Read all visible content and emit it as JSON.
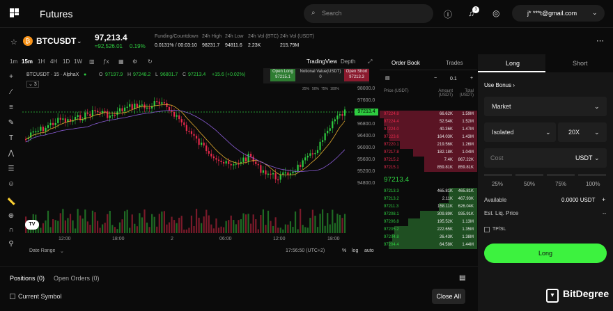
{
  "header": {
    "title": "Futures",
    "search_placeholder": "Search",
    "notif_count": "3",
    "account_email": "j* ***t@gmail.com"
  },
  "ticker": {
    "symbol": "BTCUSDT",
    "price": "97,213.4",
    "sub_price": "≈92,526.01",
    "change": "0.19%",
    "stats": [
      {
        "label": "Funding/Countdown",
        "value": "0.0131% / 00:03:10"
      },
      {
        "label": "24h High",
        "value": "98231.7"
      },
      {
        "label": "24h Low",
        "value": "94811.6"
      },
      {
        "label": "24h Vol (BTC)",
        "value": "2.23K"
      },
      {
        "label": "24h Vol (USDT)",
        "value": "215.79M"
      }
    ]
  },
  "chart": {
    "timeframes": [
      "1m",
      "15m",
      "1H",
      "4H",
      "1D",
      "1W"
    ],
    "view_tabs": [
      "TradingView",
      "Depth"
    ],
    "legend_symbol": "BTCUSDT · 15 · AlphaX",
    "ohlc": {
      "o_label": "O",
      "o": "97197.9",
      "h_label": "H",
      "h": "97248.2",
      "l_label": "L",
      "l": "96801.7",
      "c_label": "C",
      "c": "97213.4",
      "change": "+15.6 (+0.02%)"
    },
    "indicator_count": "3",
    "order_box": {
      "long": "Open Long",
      "long_price": "97215.1",
      "notional": "Notional Value(USDT)",
      "short": "Open Short",
      "short_price": "97213.3",
      "notional_value": "0",
      "pcts": [
        "25%",
        "50%",
        "75%",
        "100%"
      ]
    },
    "y_ticks": [
      "98000.0",
      "97600.0",
      "96800.0",
      "96400.0",
      "96000.0",
      "95600.0",
      "95200.0",
      "94800.0"
    ],
    "price_tag": "97213.4",
    "x_ticks": [
      "12:00",
      "18:00",
      "2",
      "06:00",
      "12:00",
      "18:00"
    ],
    "date_range": "Date Range",
    "clock": "17:56:50 (UTC+2)",
    "scale_opts": [
      "%",
      "log",
      "auto"
    ]
  },
  "orderbook": {
    "tabs": [
      "Order Book",
      "Trades"
    ],
    "precision": "0.1",
    "headers": [
      "Price (USDT)",
      "Amount (USDT)",
      "Total (USDT)"
    ],
    "asks": [
      [
        "97224.8",
        "66.62K",
        "1.59M"
      ],
      [
        "97224.4",
        "52.54K",
        "1.52M"
      ],
      [
        "97224.0",
        "40.36K",
        "1.47M"
      ],
      [
        "97223.6",
        "164.03K",
        "1.43M"
      ],
      [
        "97220.1",
        "219.56K",
        "1.26M"
      ],
      [
        "97217.8",
        "182.18K",
        "1.04M"
      ],
      [
        "97215.2",
        "7.4K",
        "867.22K"
      ],
      [
        "97215.1",
        "859.81K",
        "859.81K"
      ]
    ],
    "mid": "97213.4",
    "bids": [
      [
        "97213.3",
        "465.81K",
        "465.81K"
      ],
      [
        "97213.2",
        "2.11K",
        "467.93K"
      ],
      [
        "97211.3",
        "158.11K",
        "626.04K"
      ],
      [
        "97208.1",
        "309.89K",
        "935.91K"
      ],
      [
        "97206.8",
        "195.52K",
        "1.13M"
      ],
      [
        "97205.2",
        "222.65K",
        "1.35M"
      ],
      [
        "97204.8",
        "26.43K",
        "1.38M"
      ],
      [
        "97204.4",
        "64.58K",
        "1.44M"
      ]
    ]
  },
  "trade": {
    "tabs": [
      "Long",
      "Short"
    ],
    "use_bonus": "Use Bonus",
    "order_type": "Market",
    "margin_mode": "Isolated",
    "leverage": "20X",
    "cost_label": "Cost",
    "cost_unit": "USDT",
    "pcts": [
      "25%",
      "50%",
      "75%",
      "100%"
    ],
    "available_label": "Available",
    "available_value": "0.0000 USDT",
    "liq_label": "Est. Liq. Price",
    "liq_value": "--",
    "tpsl": "TP/SL",
    "submit": "Long"
  },
  "bottom": {
    "positions": "Positions (0)",
    "open_orders": "Open Orders (0)",
    "current_symbol": "Current Symbol",
    "close_all": "Close All",
    "watermark": "BitDegree"
  },
  "colors": {
    "green": "#2ecc40",
    "red": "#e5294b",
    "accent": "#3df23f"
  }
}
